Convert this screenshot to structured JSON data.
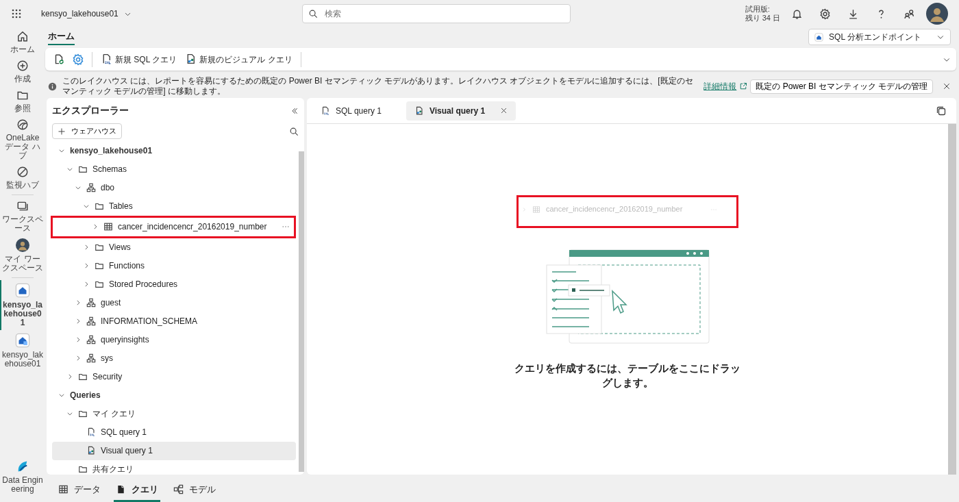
{
  "topbar": {
    "workspace": "kensyo_lakehouse01",
    "search": {
      "placeholder": "検索"
    },
    "trial": [
      "試用版:",
      "残り 34 日"
    ]
  },
  "rail": [
    {
      "kind": "home",
      "label": "ホーム",
      "selected": false
    },
    {
      "kind": "create",
      "label": "作成",
      "selected": false
    },
    {
      "kind": "browse",
      "label": "参照",
      "selected": false
    },
    {
      "kind": "onelake",
      "label": "OneLake データ ハブ",
      "selected": false
    },
    {
      "kind": "monitor",
      "label": "監視ハブ",
      "selected": false
    },
    {
      "kind": "workspaces",
      "label": "ワークスペース",
      "selected": false
    },
    {
      "kind": "avatar",
      "label": "マイ ワークスペース",
      "selected": false
    },
    {
      "kind": "lakehouse",
      "label": "kensyo_lakehouse01",
      "selected": true
    },
    {
      "kind": "endpoint",
      "label": "kensyo_lakehouse01",
      "selected": false
    }
  ],
  "rail_footer": {
    "label": "Data Engineering"
  },
  "ribbon": {
    "tabs": [
      {
        "label": "ホーム",
        "selected": true
      }
    ],
    "mode": "SQL 分析エンドポイント",
    "tools": [
      {
        "kind": "refresh"
      },
      {
        "kind": "settings"
      },
      {
        "kind": "sql",
        "label": "新規 SQL クエリ"
      },
      {
        "kind": "visual",
        "label": "新規のビジュアル クエリ"
      }
    ]
  },
  "info_bar": {
    "message": "このレイクハウス には、レポートを容易にするための既定の Power BI セマンティック モデルがあります。レイクハウス オブジェクトをモデルに追加するには、[既定のセマンティック モデルの管理] に移動します。",
    "link": "詳細情報",
    "button": "既定の Power BI セマンティック モデルの管理"
  },
  "explorer": {
    "title": "エクスプローラー",
    "add_button": "ウェアハウス"
  },
  "tree": {
    "items": [
      {
        "kind": "database",
        "label": "kensyo_lakehouse01",
        "expanded": true,
        "selected": false,
        "children": [
          {
            "kind": "folder",
            "label": "Schemas",
            "expanded": true,
            "selected": false,
            "children": [
              {
                "kind": "schema",
                "label": "dbo",
                "expanded": true,
                "selected": false,
                "children": [
                  {
                    "kind": "folder",
                    "label": "Tables",
                    "expanded": true,
                    "selected": false,
                    "children": [
                      {
                        "kind": "table",
                        "label": "cancer_incidencencr_20162019_number",
                        "expanded": false,
                        "selected": false,
                        "highlighted": true
                      }
                    ]
                  },
                  {
                    "kind": "folder",
                    "label": "Views",
                    "expanded": false,
                    "selected": false
                  },
                  {
                    "kind": "folder",
                    "label": "Functions",
                    "expanded": false,
                    "selected": false
                  },
                  {
                    "kind": "folder",
                    "label": "Stored Procedures",
                    "expanded": false,
                    "selected": false
                  }
                ]
              },
              {
                "kind": "schema",
                "label": "guest",
                "expanded": false,
                "selected": false
              },
              {
                "kind": "schema",
                "label": "INFORMATION_SCHEMA",
                "expanded": false,
                "selected": false
              },
              {
                "kind": "schema",
                "label": "queryinsights",
                "expanded": false,
                "selected": false
              },
              {
                "kind": "schema",
                "label": "sys",
                "expanded": false,
                "selected": false
              }
            ]
          },
          {
            "kind": "folder",
            "label": "Security",
            "expanded": false,
            "selected": false
          }
        ]
      },
      {
        "kind": "database",
        "label": "Queries",
        "expanded": true,
        "selected": false,
        "children": [
          {
            "kind": "folder",
            "label": "マイ クエリ",
            "expanded": true,
            "selected": false,
            "children": [
              {
                "kind": "sql",
                "label": "SQL query 1",
                "selected": false
              },
              {
                "kind": "visual",
                "label": "Visual query 1",
                "selected": true
              }
            ]
          },
          {
            "kind": "folder",
            "label": "共有クエリ",
            "selected": false
          }
        ]
      }
    ]
  },
  "editor_tabs": [
    {
      "kind": "sql",
      "label": "SQL query 1",
      "selected": false
    },
    {
      "kind": "visual",
      "label": "Visual query 1",
      "selected": true
    }
  ],
  "drag_preview": {
    "label": "cancer_incidencencr_20162019_number",
    "highlighted": true
  },
  "empty_state": {
    "message": "クエリを作成するには、テーブルをここにドラッグします。"
  },
  "bottom_tabs": [
    {
      "kind": "data",
      "label": "データ",
      "selected": false
    },
    {
      "kind": "query",
      "label": "クエリ",
      "selected": true
    },
    {
      "kind": "model",
      "label": "モデル",
      "selected": false
    }
  ]
}
